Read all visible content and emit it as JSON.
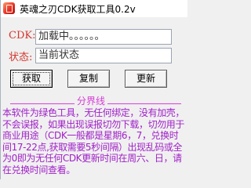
{
  "window": {
    "title": "英魂之刃CDK获取工具0.2v"
  },
  "form": {
    "cdk_label": "CDK:",
    "cdk_value": "加载中。。。。。。",
    "status_label": "状态:",
    "status_value": "当前状态"
  },
  "buttons": {
    "get": "获取",
    "copy": "复制",
    "refresh": "更新"
  },
  "divider": {
    "label": "分界线"
  },
  "info": {
    "text": "本软件为绿色工具，无任何绑定，没有加壳，不会误报，如果出现误报切勿下载，切勿用于商业用途（CDK一般都是星期6，7，兑换时间17-22点,获取需要5秒间隔）出现乱码或全为0即为无任何CDK更新时间在周六、日，请在兑换时间查看。"
  },
  "colors": {
    "label_red": "#d4362e",
    "info_purple": "#a020c8",
    "divider_magenta": "#e23ae2"
  },
  "icons": {
    "app": "app-icon"
  }
}
